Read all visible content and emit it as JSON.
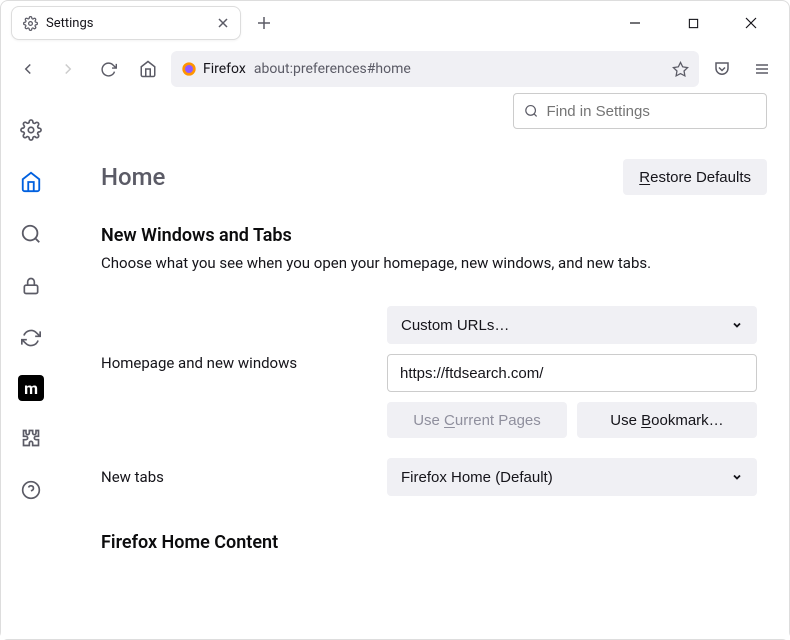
{
  "tab": {
    "title": "Settings"
  },
  "urlbar": {
    "label": "Firefox",
    "url": "about:preferences#home"
  },
  "find": {
    "placeholder": "Find in Settings"
  },
  "page": {
    "title": "Home",
    "restore_label": "Restore Defaults",
    "restore_key": "R"
  },
  "section_new": {
    "heading": "New Windows and Tabs",
    "desc": "Choose what you see when you open your homepage, new windows, and new tabs."
  },
  "homepage": {
    "dropdown_label": "Custom URLs…",
    "row_label": "Homepage and new windows",
    "url_value": "https://ftdsearch.com/",
    "use_current": "Use Current Pages",
    "use_current_key": "C",
    "use_bookmark": "Use Bookmark…",
    "use_bookmark_key": "B"
  },
  "newtabs": {
    "row_label": "New tabs",
    "dropdown_label": "Firefox Home (Default)"
  },
  "section_content": {
    "heading": "Firefox Home Content"
  }
}
